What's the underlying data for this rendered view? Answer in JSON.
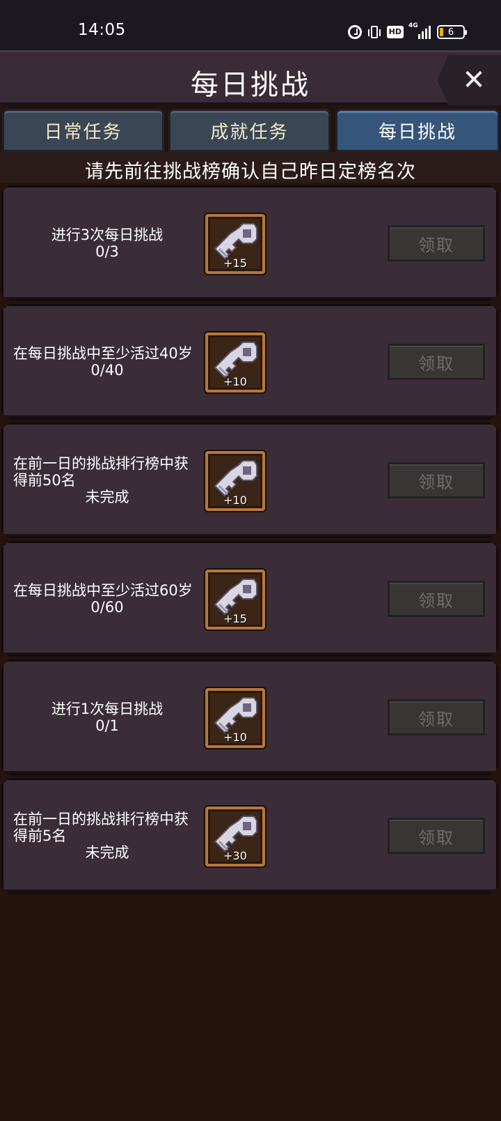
{
  "status_bar": {
    "time": "14:05",
    "icons": [
      "alarm-icon",
      "vibrate-icon",
      "hd-icon",
      "signal-4g-icon",
      "battery-icon"
    ],
    "network": "4G",
    "hd": "HD",
    "battery_level": "6"
  },
  "header": {
    "title": "每日挑战",
    "close_icon": "✕"
  },
  "tabs": [
    {
      "label": "日常任务",
      "active": false
    },
    {
      "label": "成就任务",
      "active": false
    },
    {
      "label": "每日挑战",
      "active": true
    }
  ],
  "hint": "请先前往挑战榜确认自己昨日定榜名次",
  "tasks": [
    {
      "desc": "进行3次每日挑战",
      "progress": "0/3",
      "reward": "+15",
      "button": "领取"
    },
    {
      "desc": "在每日挑战中至少活过40岁",
      "progress": "0/40",
      "reward": "+10",
      "button": "领取"
    },
    {
      "desc": "在前一日的挑战排行榜中获得前50名",
      "progress": "未完成",
      "reward": "+10",
      "button": "领取"
    },
    {
      "desc": "在每日挑战中至少活过60岁",
      "progress": "0/60",
      "reward": "+15",
      "button": "领取"
    },
    {
      "desc": "进行1次每日挑战",
      "progress": "0/1",
      "reward": "+10",
      "button": "领取"
    },
    {
      "desc": "在前一日的挑战排行榜中获得前5名",
      "progress": "未完成",
      "reward": "+30",
      "button": "领取"
    }
  ],
  "colors": {
    "background": "#24130f",
    "card": "#3a2d38",
    "tab": "#3a4654",
    "tab_active": "#35557a",
    "reward_frame": "#b6783c",
    "button_disabled": "#383534"
  }
}
